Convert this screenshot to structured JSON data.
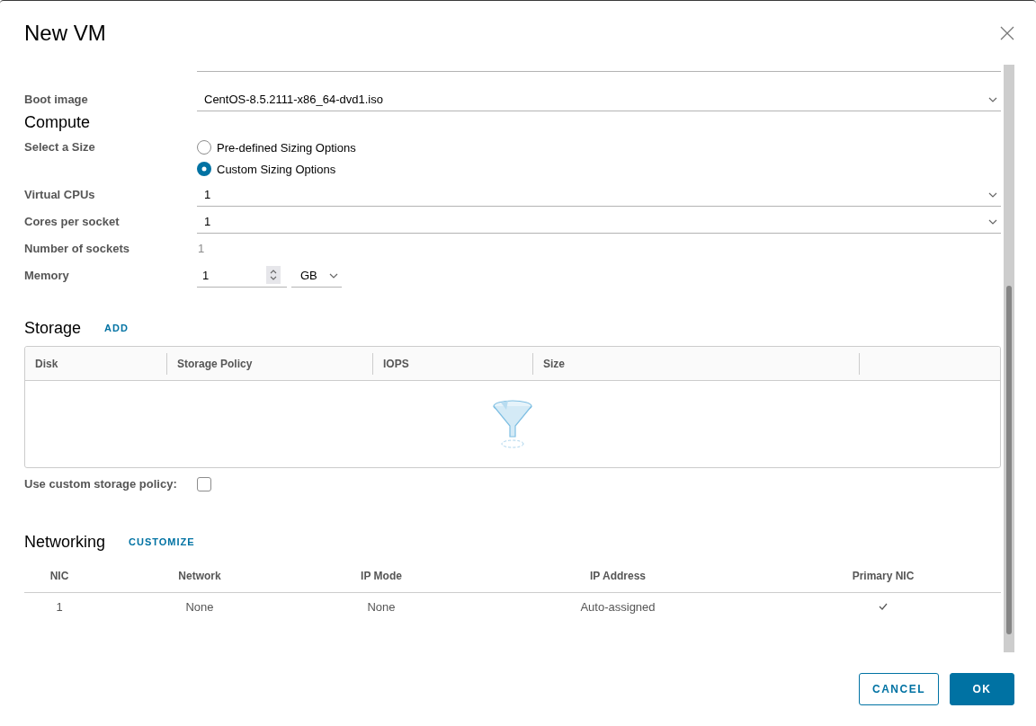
{
  "dialog": {
    "title": "New VM"
  },
  "general": {
    "boot_image": {
      "kind": "select",
      "label": "Boot image",
      "value": "CentOS-8.5.2111-x86_64-dvd1.iso"
    }
  },
  "compute": {
    "heading": "Compute",
    "size": {
      "label": "Select a Size",
      "options": [
        {
          "label": "Pre-defined Sizing Options",
          "selected": false
        },
        {
          "label": "Custom Sizing Options",
          "selected": true
        }
      ]
    },
    "fields": [
      {
        "kind": "select",
        "label": "Virtual CPUs",
        "value": "1"
      },
      {
        "kind": "select",
        "label": "Cores per socket",
        "value": "1"
      },
      {
        "kind": "readonly",
        "label": "Number of sockets",
        "value": "1"
      },
      {
        "kind": "memory",
        "label": "Memory",
        "value": "1",
        "unit": "GB"
      }
    ]
  },
  "storage": {
    "heading": "Storage",
    "action": "ADD",
    "table": {
      "columns": [
        "Disk",
        "Storage Policy",
        "IOPS",
        "Size"
      ]
    },
    "custom_policy": {
      "label": "Use custom storage policy:",
      "checked": false
    }
  },
  "networking": {
    "heading": "Networking",
    "action": "CUSTOMIZE",
    "table": {
      "columns": [
        "NIC",
        "Network",
        "IP Mode",
        "IP Address",
        "Primary NIC"
      ],
      "rows": [
        {
          "nic": "1",
          "network": "None",
          "ip_mode": "None",
          "ip_address": "Auto-assigned",
          "primary": true
        }
      ]
    }
  },
  "buttons": [
    {
      "label": "CANCEL",
      "kind": "secondary"
    },
    {
      "label": "OK",
      "kind": "primary"
    }
  ]
}
